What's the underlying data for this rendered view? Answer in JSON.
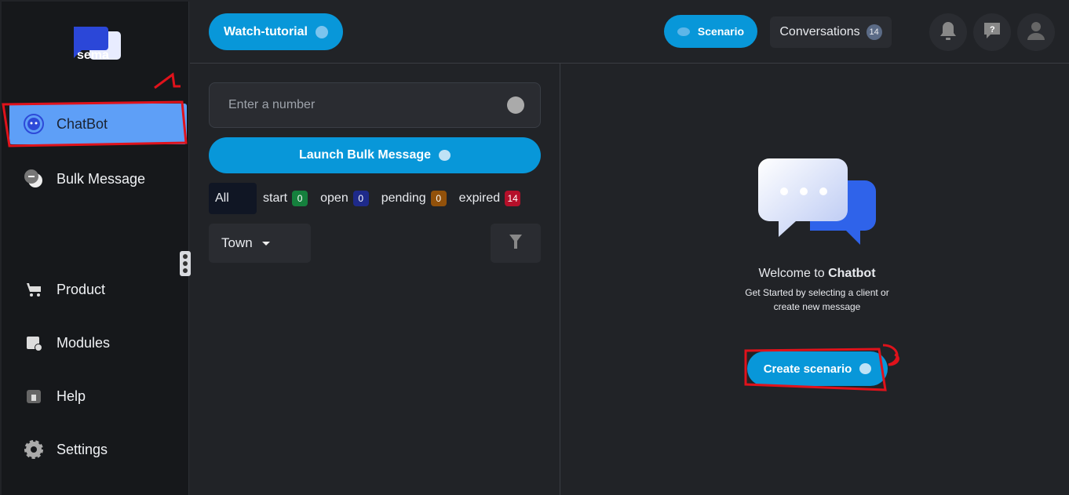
{
  "brand": {
    "logo_text": "sema"
  },
  "sidebar": {
    "items": [
      {
        "label": "ChatBot",
        "icon": "robot-icon",
        "active": true
      },
      {
        "label": "Bulk Message",
        "icon": "chat-bubbles-icon"
      },
      {
        "label": "Product",
        "icon": "cart-icon"
      },
      {
        "label": "Modules",
        "icon": "calendar-add-icon"
      },
      {
        "label": "Help",
        "icon": "help-box-icon"
      },
      {
        "label": "Settings",
        "icon": "gear-icon"
      }
    ]
  },
  "header": {
    "watch_tutorial": "Watch-tutorial",
    "scenario": "Scenario",
    "conversations": "Conversations",
    "conversations_count": "14"
  },
  "left": {
    "number_placeholder": "Enter a number",
    "launch_bulk": "Launch Bulk Message",
    "tabs": [
      {
        "label": "All"
      },
      {
        "label": "start",
        "count": "0",
        "color": "#15803d"
      },
      {
        "label": "open",
        "count": "0",
        "color": "#1e2a8a"
      },
      {
        "label": "pending",
        "count": "0",
        "color": "#92510a"
      },
      {
        "label": "expired",
        "count": "14",
        "color": "#b5102a"
      }
    ],
    "town": "Town"
  },
  "welcome": {
    "title_prefix": "Welcome to ",
    "title_bold": "Chatbot",
    "line1": "Get Started by selecting a client or",
    "line2": "create new message",
    "create_button": "Create scenario"
  },
  "annotations": {
    "mark1": "1",
    "mark2": "2"
  },
  "colors": {
    "accent": "#0897d9",
    "active_nav": "#5e9ff7",
    "annotation": "#e0121b"
  }
}
